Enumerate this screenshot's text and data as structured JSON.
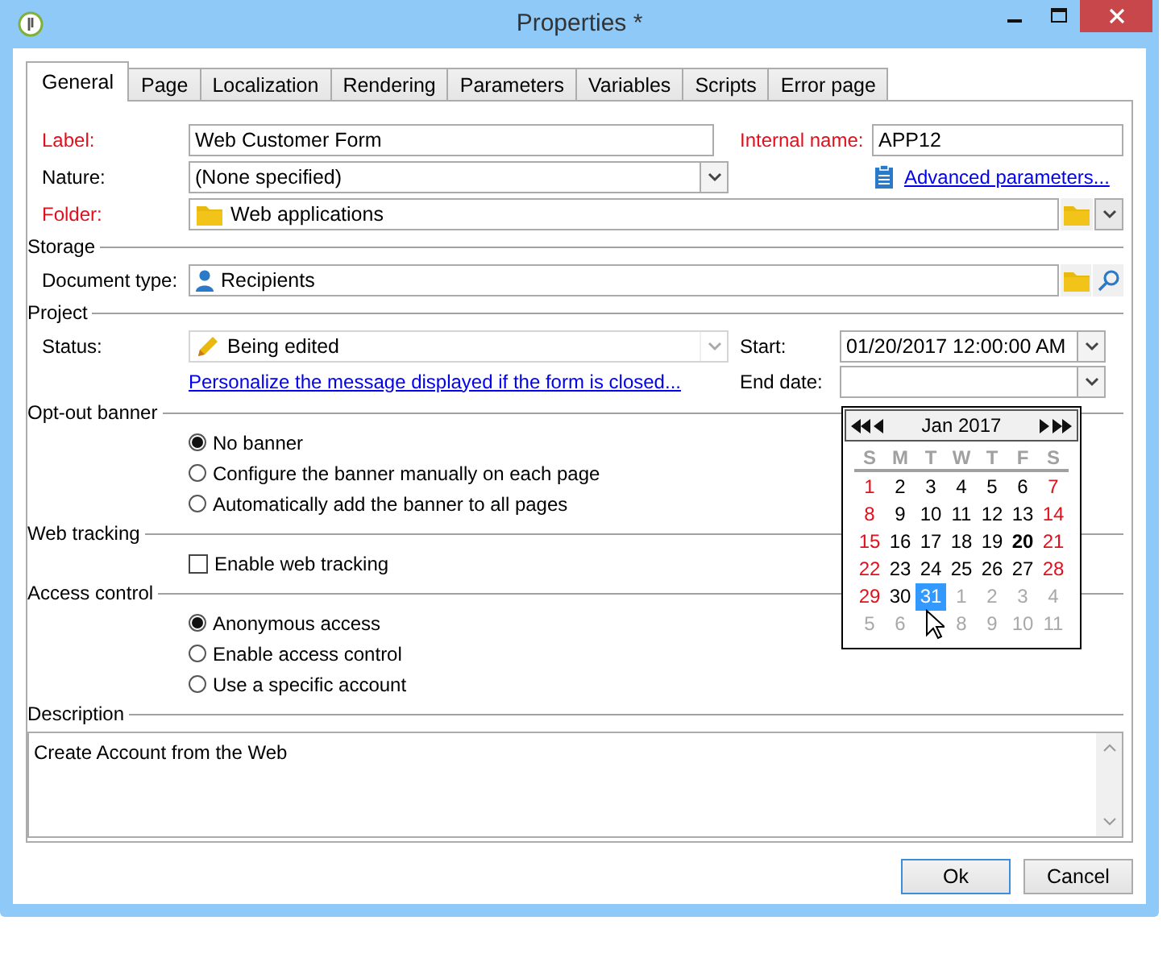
{
  "window": {
    "title": "Properties *"
  },
  "tabs": [
    {
      "label": "General",
      "selected": true
    },
    {
      "label": "Page",
      "selected": false
    },
    {
      "label": "Localization",
      "selected": false
    },
    {
      "label": "Rendering",
      "selected": false
    },
    {
      "label": "Parameters",
      "selected": false
    },
    {
      "label": "Variables",
      "selected": false
    },
    {
      "label": "Scripts",
      "selected": false
    },
    {
      "label": "Error page",
      "selected": false
    }
  ],
  "label_field": {
    "label": "Label:",
    "required": true,
    "value": "Web Customer Form"
  },
  "internal_name": {
    "label": "Internal name:",
    "required": true,
    "value": "APP12"
  },
  "nature": {
    "label": "Nature:",
    "required": false,
    "value": "(None specified)"
  },
  "advanced_link": "Advanced parameters...",
  "folder": {
    "label": "Folder:",
    "required": true,
    "value": "Web applications"
  },
  "storage": {
    "heading": "Storage",
    "document_type": {
      "label": "Document type:",
      "required": false,
      "value": "Recipients"
    }
  },
  "project": {
    "heading": "Project",
    "status": {
      "label": "Status:",
      "required": false,
      "value": "Being edited",
      "disabled": true
    },
    "start": {
      "label": "Start:",
      "value": "01/20/2017 12:00:00 AM"
    },
    "end_date": {
      "label": "End date:"
    },
    "personalize_link": "Personalize the message displayed if the form is closed..."
  },
  "calendar": {
    "month": "Jan 2017",
    "weekdays": [
      "S",
      "M",
      "T",
      "W",
      "T",
      "F",
      "S"
    ],
    "days": [
      {
        "day": "1",
        "kind": "weekend",
        "selected": false
      },
      {
        "day": "2",
        "kind": "weekday",
        "selected": false
      },
      {
        "day": "3",
        "kind": "weekday",
        "selected": false
      },
      {
        "day": "4",
        "kind": "weekday",
        "selected": false
      },
      {
        "day": "5",
        "kind": "weekday",
        "selected": false
      },
      {
        "day": "6",
        "kind": "weekday",
        "selected": false
      },
      {
        "day": "7",
        "kind": "weekend",
        "selected": false
      },
      {
        "day": "8",
        "kind": "weekend",
        "selected": false
      },
      {
        "day": "9",
        "kind": "weekday",
        "selected": false
      },
      {
        "day": "10",
        "kind": "weekday",
        "selected": false
      },
      {
        "day": "11",
        "kind": "weekday",
        "selected": false
      },
      {
        "day": "12",
        "kind": "weekday",
        "selected": false
      },
      {
        "day": "13",
        "kind": "weekday",
        "selected": false
      },
      {
        "day": "14",
        "kind": "weekend",
        "selected": false
      },
      {
        "day": "15",
        "kind": "weekend",
        "selected": false
      },
      {
        "day": "16",
        "kind": "weekday",
        "selected": false
      },
      {
        "day": "17",
        "kind": "weekday",
        "selected": false
      },
      {
        "day": "18",
        "kind": "weekday",
        "selected": false
      },
      {
        "day": "19",
        "kind": "weekday",
        "selected": false
      },
      {
        "day": "20",
        "kind": "start",
        "selected": false
      },
      {
        "day": "21",
        "kind": "weekend",
        "selected": false
      },
      {
        "day": "22",
        "kind": "weekend",
        "selected": false
      },
      {
        "day": "23",
        "kind": "weekday",
        "selected": false
      },
      {
        "day": "24",
        "kind": "weekday",
        "selected": false
      },
      {
        "day": "25",
        "kind": "weekday",
        "selected": false
      },
      {
        "day": "26",
        "kind": "weekday",
        "selected": false
      },
      {
        "day": "27",
        "kind": "weekday",
        "selected": false
      },
      {
        "day": "28",
        "kind": "weekend",
        "selected": false
      },
      {
        "day": "29",
        "kind": "weekend",
        "selected": false
      },
      {
        "day": "30",
        "kind": "weekday",
        "selected": false
      },
      {
        "day": "31",
        "kind": "weekday",
        "selected": true
      },
      {
        "day": "1",
        "kind": "other",
        "selected": false
      },
      {
        "day": "2",
        "kind": "other",
        "selected": false
      },
      {
        "day": "3",
        "kind": "other",
        "selected": false
      },
      {
        "day": "4",
        "kind": "other",
        "selected": false
      },
      {
        "day": "5",
        "kind": "other",
        "selected": false
      },
      {
        "day": "6",
        "kind": "other",
        "selected": false
      },
      {
        "kind": "covered",
        "selected": false
      },
      {
        "day": "8",
        "kind": "other",
        "selected": false
      },
      {
        "day": "9",
        "kind": "other",
        "selected": false
      },
      {
        "day": "10",
        "kind": "other",
        "selected": false
      },
      {
        "day": "11",
        "kind": "other",
        "selected": false
      }
    ]
  },
  "opt_out_banner": {
    "heading": "Opt-out banner",
    "options": [
      {
        "label": "No banner",
        "selected": true
      },
      {
        "label": "Configure the banner manually on each page",
        "selected": false
      },
      {
        "label": "Automatically add the banner to all pages",
        "selected": false
      }
    ]
  },
  "web_tracking": {
    "heading": "Web tracking",
    "checkbox": {
      "label": "Enable web tracking",
      "checked": false
    }
  },
  "access_control": {
    "heading": "Access control",
    "options": [
      {
        "label": "Anonymous access",
        "selected": true
      },
      {
        "label": "Enable access control",
        "selected": false
      },
      {
        "label": "Use a specific account",
        "selected": false
      }
    ]
  },
  "description": {
    "heading": "Description",
    "value": "Create Account from the Web"
  },
  "buttons": [
    {
      "label": "Ok",
      "default": true
    },
    {
      "label": "Cancel",
      "default": false
    }
  ]
}
